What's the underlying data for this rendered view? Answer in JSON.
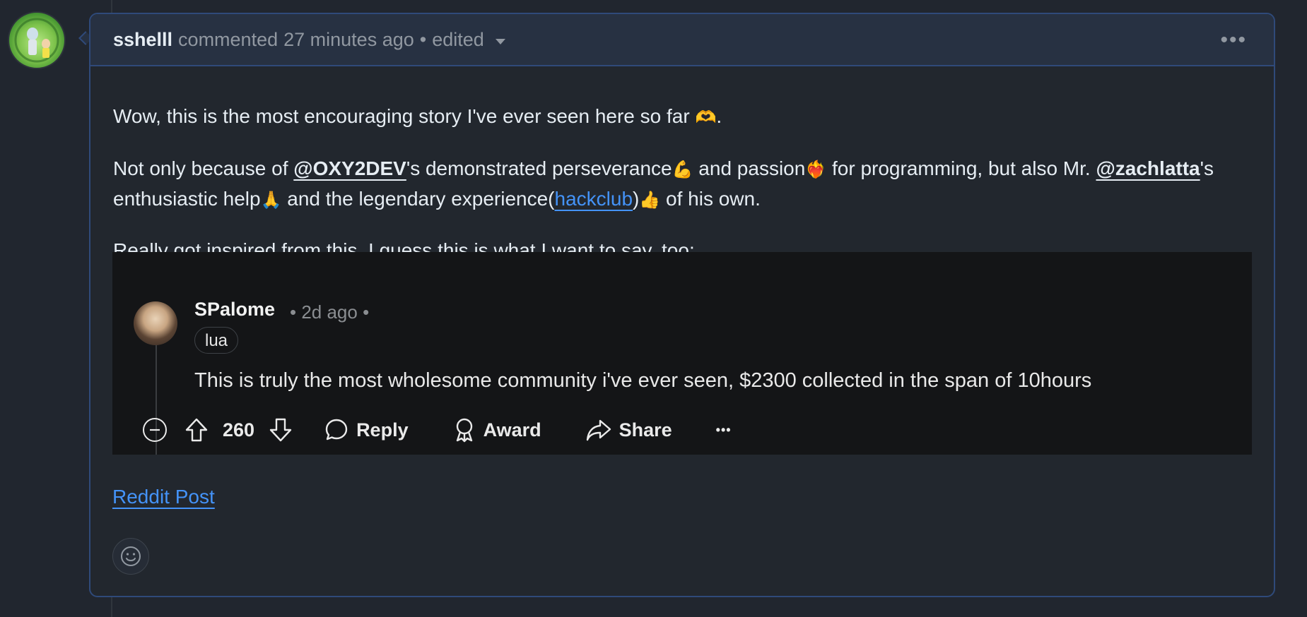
{
  "header": {
    "author": "sshelll",
    "action": "commented",
    "time": "27 minutes ago",
    "separator": "•",
    "edited": "edited",
    "more_label": "•••"
  },
  "body": {
    "p1": {
      "text": "Wow, this is the most encouraging story I've ever seen here so far ",
      "emoji": "🫶",
      "end": "."
    },
    "p2": {
      "t1": "Not only because of ",
      "mention1": "@OXY2DEV",
      "t2": "'s demonstrated perseverance",
      "emoji1": "💪",
      "t3": " and passion",
      "emoji2": "❤️‍🔥",
      "t4": " for programming, but also Mr. ",
      "mention2": "@zachlatta",
      "t5": "'s enthusiastic help",
      "emoji3": "🙏",
      "t6": " and the legendary experience(",
      "link": "hackclub",
      "t7": ")",
      "emoji4": "👍",
      "t8": " of his own."
    },
    "p3": "Really got inspired from this. I guess this is what I want to say, too:"
  },
  "embed": {
    "username": "SPalome",
    "time": "• 2d ago •",
    "flair": "lua",
    "text": "This is truly the most wholesome community i've ever seen, $2300 collected in the span of 10hours",
    "score": "260",
    "reply_label": "Reply",
    "award_label": "Award",
    "share_label": "Share",
    "more_label": "•••"
  },
  "footer": {
    "link": "Reddit Post"
  },
  "colors": {
    "background": "#21262f",
    "border_accent": "#2f4a7a",
    "link": "#4493f8",
    "embed_bg": "#141517"
  }
}
